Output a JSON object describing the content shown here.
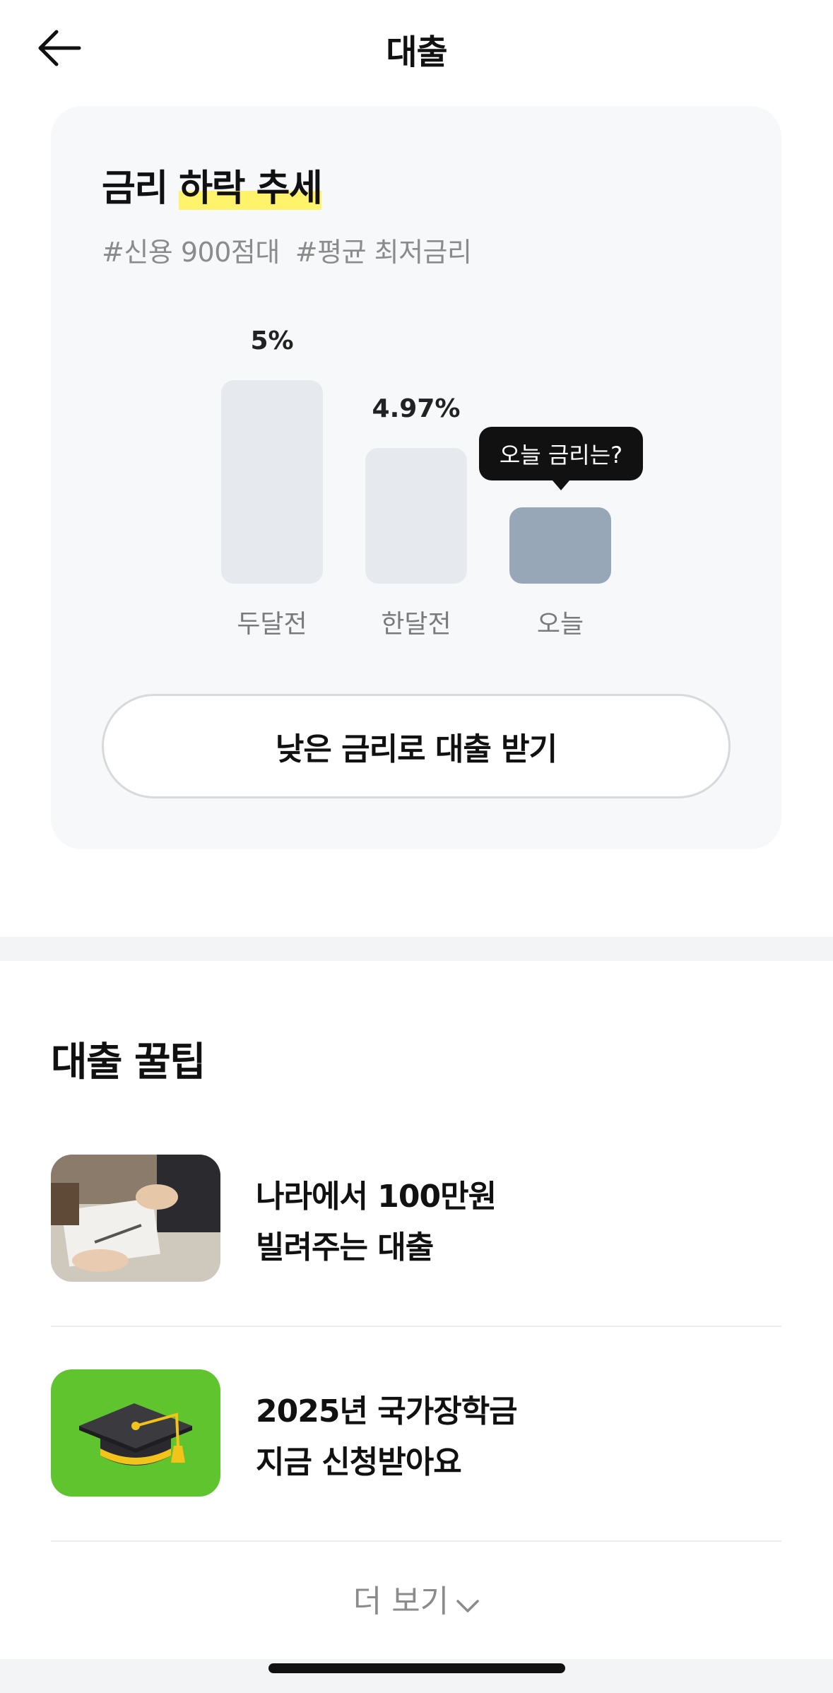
{
  "header": {
    "title": "대출",
    "back_icon": "arrow-left-icon"
  },
  "rate_card": {
    "title_plain": "금리 ",
    "title_highlight": "하락 추세",
    "tags": [
      "#신용 900점대",
      "#평균 최저금리"
    ],
    "tooltip": "오늘 금리는?",
    "cta_label": "낮은 금리로 대출 받기"
  },
  "chart_data": {
    "type": "bar",
    "categories": [
      "두달전",
      "한달전",
      "오늘"
    ],
    "values": [
      5,
      4.97,
      null
    ],
    "value_labels": [
      "5%",
      "4.97%",
      ""
    ],
    "highlight_color": "#97a7b8",
    "bar_color": "#e6eaef"
  },
  "tips": {
    "title": "대출 꿀팁",
    "items": [
      {
        "line1": "나라에서 100만원",
        "line2": "빌려주는 대출",
        "thumb": "office-handshake-photo"
      },
      {
        "line1": "2025년 국가장학금",
        "line2": "지금 신청받아요",
        "thumb": "graduation-cap-icon"
      }
    ],
    "more_label": "더 보기",
    "more_icon": "chevron-down-icon"
  }
}
